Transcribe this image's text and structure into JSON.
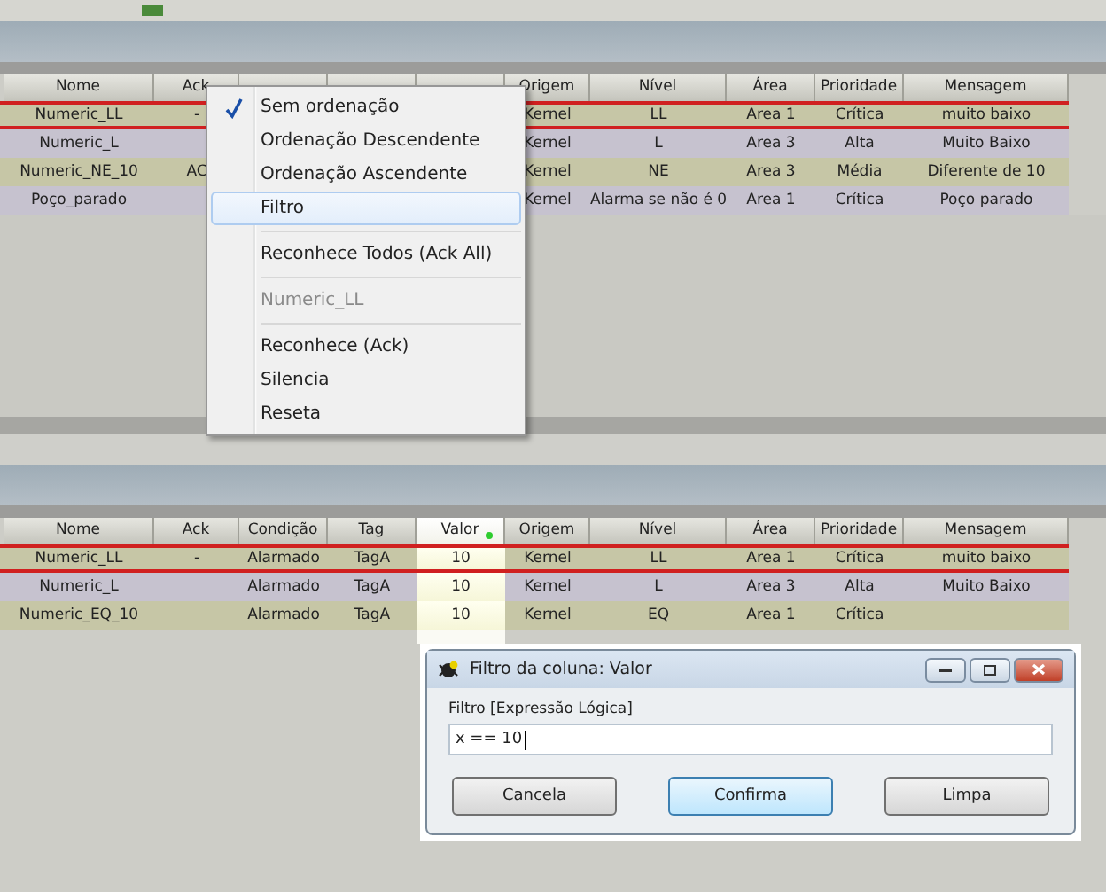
{
  "top_table": {
    "columns": [
      "Nome",
      "Ack",
      null,
      null,
      null,
      "Origem",
      "Nível",
      "Área",
      "Prioridade",
      "Mensagem"
    ],
    "rows": [
      {
        "selected": true,
        "cells": [
          "Numeric_LL",
          "-",
          "",
          "",
          "",
          "Kernel",
          "LL",
          "Area 1",
          "Crítica",
          "muito baixo"
        ]
      },
      {
        "selected": false,
        "cells": [
          "Numeric_L",
          "",
          "",
          "",
          "",
          "Kernel",
          "L",
          "Area 3",
          "Alta",
          "Muito Baixo"
        ]
      },
      {
        "selected": false,
        "cells": [
          "Numeric_NE_10",
          "AC",
          "",
          "",
          "",
          "Kernel",
          "NE",
          "Area 3",
          "Média",
          "Diferente de 10"
        ]
      },
      {
        "selected": false,
        "cells": [
          "Poço_parado",
          "",
          "",
          "",
          "",
          "Kernel",
          "Alarma se não é 0",
          "Area 1",
          "Crítica",
          "Poço parado"
        ]
      }
    ]
  },
  "context_menu": {
    "items": [
      {
        "kind": "item",
        "label": "Sem ordenação",
        "checked": true,
        "selected": false,
        "disabled": false
      },
      {
        "kind": "item",
        "label": "Ordenação Descendente",
        "checked": false,
        "selected": false,
        "disabled": false
      },
      {
        "kind": "item",
        "label": "Ordenação Ascendente",
        "checked": false,
        "selected": false,
        "disabled": false
      },
      {
        "kind": "item",
        "label": "Filtro",
        "checked": false,
        "selected": true,
        "disabled": false
      },
      {
        "kind": "separator"
      },
      {
        "kind": "item",
        "label": "Reconhece Todos (Ack All)",
        "checked": false,
        "selected": false,
        "disabled": false
      },
      {
        "kind": "separator"
      },
      {
        "kind": "item",
        "label": "Numeric_LL",
        "checked": false,
        "selected": false,
        "disabled": true
      },
      {
        "kind": "separator"
      },
      {
        "kind": "item",
        "label": "Reconhece (Ack)",
        "checked": false,
        "selected": false,
        "disabled": false
      },
      {
        "kind": "item",
        "label": "Silencia",
        "checked": false,
        "selected": false,
        "disabled": false
      },
      {
        "kind": "item",
        "label": "Reseta",
        "checked": false,
        "selected": false,
        "disabled": false
      }
    ]
  },
  "bottom_table": {
    "columns": [
      {
        "label": "Nome",
        "filtered": false
      },
      {
        "label": "Ack",
        "filtered": false
      },
      {
        "label": "Condição",
        "filtered": false
      },
      {
        "label": "Tag",
        "filtered": false
      },
      {
        "label": "Valor",
        "filtered": true
      },
      {
        "label": "Origem",
        "filtered": false
      },
      {
        "label": "Nível",
        "filtered": false
      },
      {
        "label": "Área",
        "filtered": false
      },
      {
        "label": "Prioridade",
        "filtered": false
      },
      {
        "label": "Mensagem",
        "filtered": false
      }
    ],
    "rows": [
      {
        "selected": true,
        "cells": [
          "Numeric_LL",
          "-",
          "Alarmado",
          "TagA",
          "10",
          "Kernel",
          "LL",
          "Area 1",
          "Crítica",
          "muito baixo"
        ]
      },
      {
        "selected": false,
        "cells": [
          "Numeric_L",
          "",
          "Alarmado",
          "TagA",
          "10",
          "Kernel",
          "L",
          "Area 3",
          "Alta",
          "Muito Baixo"
        ]
      },
      {
        "selected": false,
        "cells": [
          "Numeric_EQ_10",
          "",
          "Alarmado",
          "TagA",
          "10",
          "Kernel",
          "EQ",
          "Area 1",
          "Crítica",
          ""
        ]
      }
    ]
  },
  "dialog": {
    "title": "Filtro da coluna: Valor",
    "field_label": "Filtro [Expressão Lógica]",
    "value": "x == 10",
    "buttons": [
      {
        "label": "Cancela",
        "focused": false
      },
      {
        "label": "Confirma",
        "focused": true
      },
      {
        "label": "Limpa",
        "focused": false
      }
    ]
  }
}
